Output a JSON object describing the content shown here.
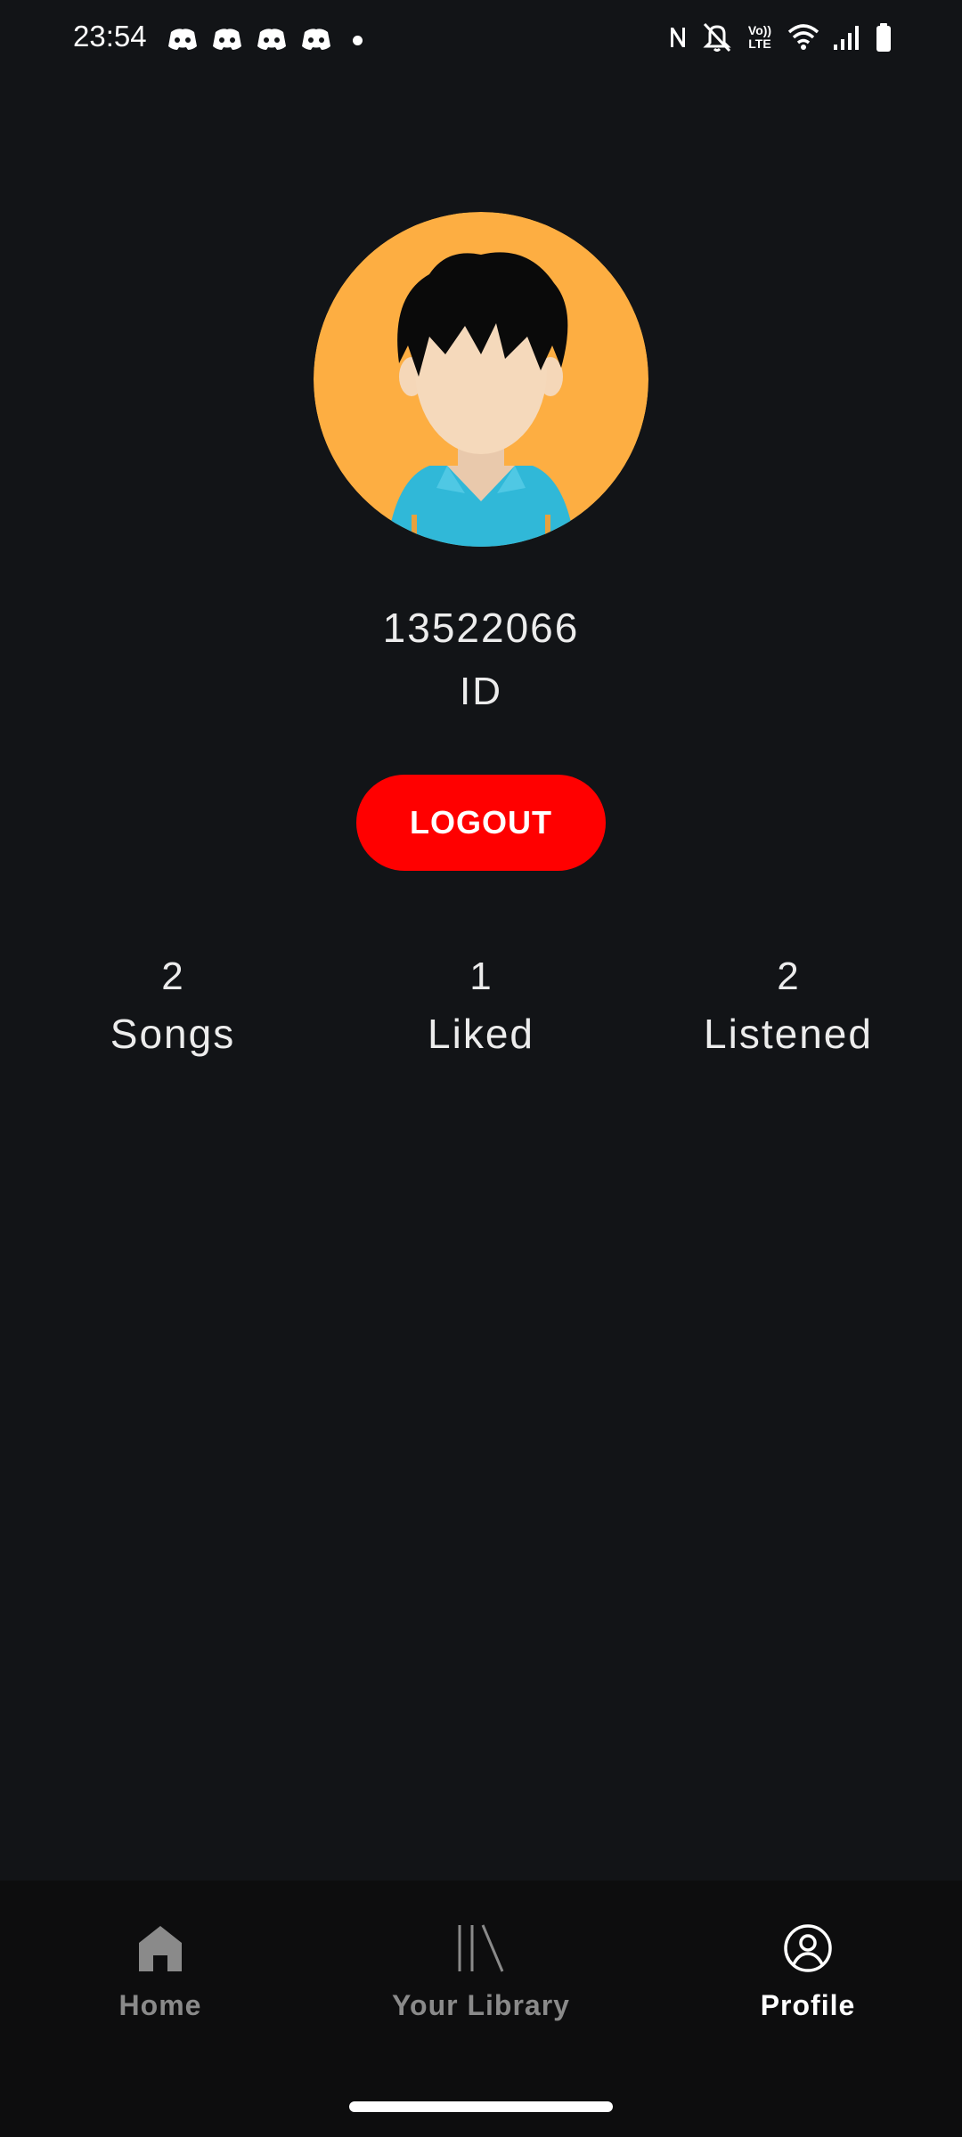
{
  "status_bar": {
    "time": "23:54",
    "notification_icons": [
      "discord-icon",
      "discord-icon",
      "discord-icon",
      "discord-icon",
      "dot-icon"
    ],
    "system_icons": [
      "nfc-icon",
      "bell-off-icon",
      "volte-icon",
      "wifi-icon",
      "signal-icon",
      "battery-icon"
    ],
    "volte_text": "Vo)) LTE"
  },
  "profile": {
    "user_id": "13522066",
    "id_label": "ID",
    "logout_label": "LOGOUT"
  },
  "stats": [
    {
      "value": "2",
      "label": "Songs"
    },
    {
      "value": "1",
      "label": "Liked"
    },
    {
      "value": "2",
      "label": "Listened"
    }
  ],
  "nav": {
    "items": [
      {
        "label": "Home",
        "icon": "home-icon",
        "active": false
      },
      {
        "label": "Your Library",
        "icon": "library-icon",
        "active": false
      },
      {
        "label": "Profile",
        "icon": "profile-icon",
        "active": true
      }
    ]
  },
  "colors": {
    "background": "#121417",
    "logout": "#ff0000",
    "avatar_bg": "#fdae42",
    "nav_bg": "#0d0d0e",
    "inactive": "#8a8a8a"
  }
}
